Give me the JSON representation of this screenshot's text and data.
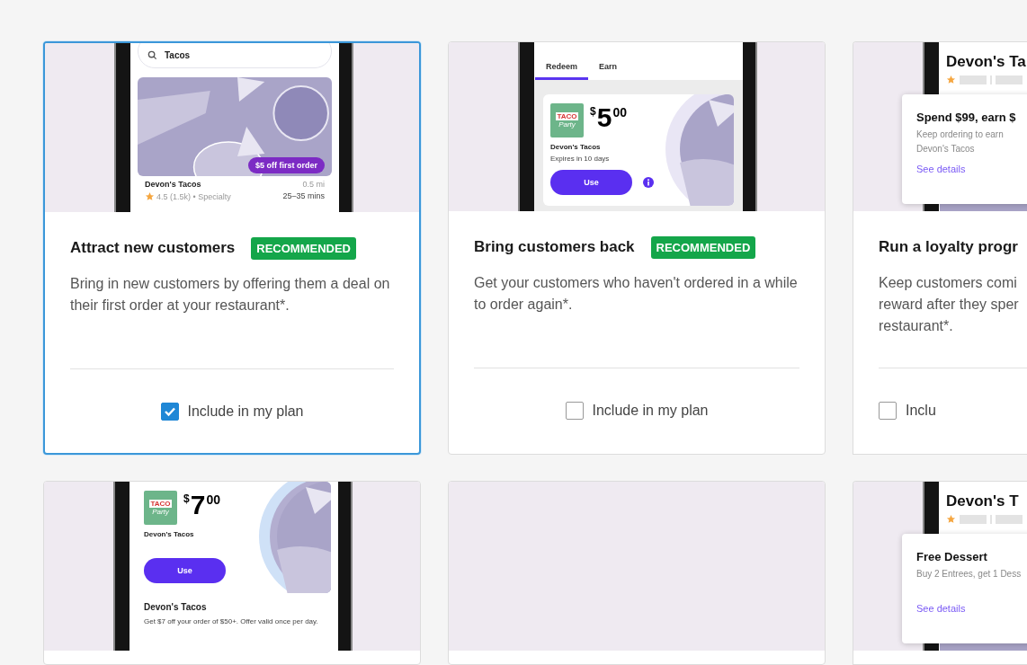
{
  "cards": [
    {
      "selected": true,
      "title": "Attract new customers",
      "badge": "RECOMMENDED",
      "description": "Bring in new customers by offering them a deal on their first order at your restaurant*.",
      "checkbox": {
        "label": "Include in my plan",
        "checked": true
      },
      "phone": {
        "kind": "search",
        "search_value": "Tacos",
        "promo": "$5 off first order",
        "name": "Devon's Tacos",
        "distance": "0.5 mi",
        "rating": "4.5 (1.5k) • Specialty",
        "time": "25–35 mins"
      }
    },
    {
      "selected": false,
      "title": "Bring customers back",
      "badge": "RECOMMENDED",
      "description": "Get your customers who haven't ordered in a while to order again*.",
      "checkbox": {
        "label": "Include in my plan",
        "checked": false
      },
      "phone": {
        "kind": "redeem",
        "tabs": [
          {
            "label": "Redeem",
            "selected": true
          },
          {
            "label": "Earn",
            "selected": false
          }
        ],
        "logo_top": "TACO",
        "logo_bottom": "Party",
        "currency": "$",
        "amount": "5",
        "cents": "00",
        "name": "Devon's Tacos",
        "note": "Expires in 10 days",
        "button": "Use"
      }
    },
    {
      "selected": false,
      "title": "Run a loyalty progr",
      "description": "Keep customers comi\nreward after they sper\nrestaurant*.",
      "checkbox": {
        "label": "Inclu",
        "checked": false
      },
      "phone": {
        "kind": "popup",
        "name": "Devon's Ta",
        "popup_title": "Spend $99, earn $",
        "popup_text": "Keep ordering to earn\nDevon's Tacos",
        "link": "See details"
      }
    },
    {
      "selected": false,
      "phone": {
        "kind": "coupon",
        "logo_top": "TACO",
        "logo_bottom": "Party",
        "currency": "$",
        "amount": "7",
        "cents": "00",
        "name": "Devon's Tacos",
        "button": "Use",
        "heading": "Devon's Tacos",
        "text": "Get $7 off your order of $50+. Offer valid once per day."
      }
    },
    {
      "selected": false
    },
    {
      "selected": false,
      "phone": {
        "kind": "popup",
        "name": "Devon's T",
        "popup_title": "Free Dessert",
        "popup_text": "Buy 2 Entrees, get 1 Dess",
        "link": "See details"
      }
    }
  ]
}
